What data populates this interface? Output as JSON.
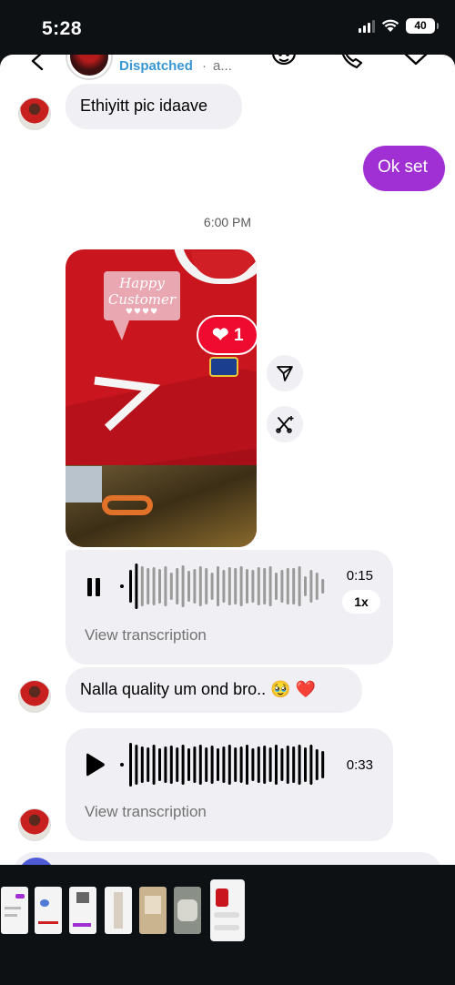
{
  "status_bar": {
    "time": "5:28",
    "battery": "40"
  },
  "header": {
    "status": "Dispatched",
    "separator": "·",
    "subtitle": "a...",
    "peek_letter": "2"
  },
  "messages": [
    {
      "id": "m1",
      "direction": "received",
      "text": "Ethiyitt pic idaave"
    },
    {
      "id": "m2",
      "direction": "sent",
      "text": "Ok set"
    }
  ],
  "timestamp": "6:00 PM",
  "photo": {
    "sticker_line1": "Happy",
    "sticker_line2": "Customer",
    "sticker_hearts": "♥♥♥♥",
    "jersey_number": "7",
    "reaction_emoji": "❤",
    "reaction_count": "1"
  },
  "voice_messages": [
    {
      "duration": "0:15",
      "speed": "1x",
      "state": "playing",
      "link": "View transcription"
    },
    {
      "duration": "0:33",
      "state": "paused",
      "link": "View transcription"
    }
  ],
  "text_message": {
    "text": "Nalla quality um ond bro..",
    "emojis": "🥹 ❤️"
  },
  "colors": {
    "sent_bubble": "#a130d4",
    "received_bubble": "#efeff4",
    "status_link": "#3897d4",
    "reaction": "#ef0a2f"
  },
  "icons": [
    "back-icon",
    "phone-icon",
    "video-icon",
    "send-icon",
    "remix-icon",
    "pause-icon",
    "play-icon"
  ]
}
